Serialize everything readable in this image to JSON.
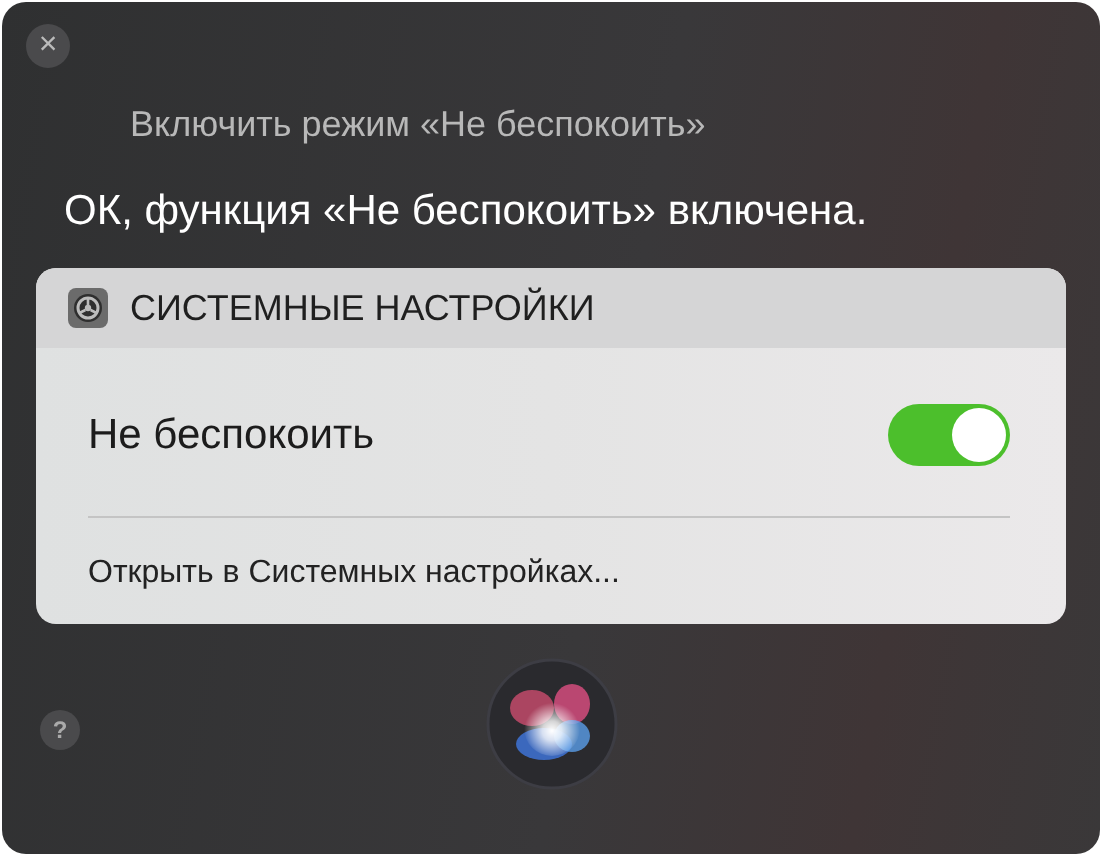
{
  "close_button": "×",
  "query": "Включить режим «Не беспокоить»",
  "response": "ОК, функция «Не беспокоить» включена.",
  "card": {
    "app_title": "СИСТЕМНЫЕ НАСТРОЙКИ",
    "setting": {
      "label": "Не беспокоить",
      "on": true
    },
    "link": "Открыть в Системных настройках..."
  },
  "help_button": "?"
}
